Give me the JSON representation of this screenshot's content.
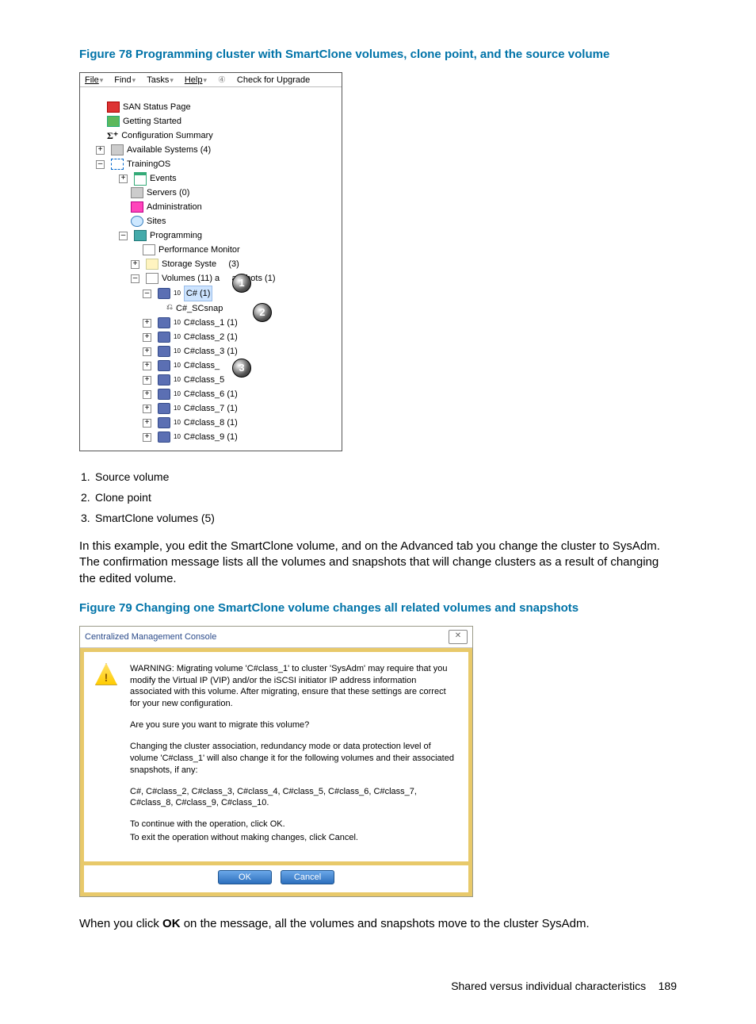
{
  "figure78": {
    "title": "Figure 78 Programming cluster with SmartClone volumes, clone point, and the source volume",
    "menubar": {
      "file": "File",
      "find": "Find",
      "tasks": "Tasks",
      "help": "Help",
      "check": "Check for Upgrade"
    },
    "tree": {
      "san": "SAN Status Page",
      "getting": "Getting Started",
      "config": "Configuration Summary",
      "avail": "Available Systems (4)",
      "training": "TrainingOS",
      "events": "Events",
      "servers": "Servers (0)",
      "admin": "Administration",
      "sites": "Sites",
      "programming": "Programming",
      "perf": "Performance Monitor",
      "storage_pre": "Storage Syste",
      "storage_post": "(3)",
      "volumes_pre": "Volumes (11) a",
      "volumes_post": "apshots (1)",
      "csharp": "C# (1)",
      "scsnap": "C#_SCsnap",
      "c1": "C#class_1 (1)",
      "c2": "C#class_2 (1)",
      "c3": "C#class_3 (1)",
      "c4pre": "C#class_",
      "c5": "C#class_5",
      "c6": "C#class_6 (1)",
      "c7": "C#class_7 (1)",
      "c8": "C#class_8 (1)",
      "c9": "C#class_9 (1)"
    },
    "callouts": {
      "one": "1",
      "two": "2",
      "three": "3"
    }
  },
  "legend": {
    "i1": "1.",
    "t1": "Source volume",
    "i2": "2.",
    "t2": "Clone point",
    "i3": "3.",
    "t3": "SmartClone volumes (5)"
  },
  "para1": "In this example, you edit the SmartClone volume, and on the Advanced tab you change the cluster to SysAdm. The confirmation message lists all the volumes and snapshots that will change clusters as a result of changing the edited volume.",
  "figure79": {
    "title": "Figure 79 Changing one SmartClone volume changes all related volumes and snapshots",
    "dialog_title": "Centralized Management Console",
    "p1": "WARNING: Migrating volume 'C#class_1' to cluster 'SysAdm' may require that you modify the Virtual IP (VIP) and/or the iSCSI initiator IP address information associated with this volume. After migrating, ensure that these settings are correct for your new configuration.",
    "p2": "Are you sure you want to migrate this volume?",
    "p3": "Changing the cluster association, redundancy mode or data protection level of volume 'C#class_1' will also change it for the following volumes and their associated snapshots, if any:",
    "p4": "C#, C#class_2, C#class_3, C#class_4, C#class_5, C#class_6, C#class_7, C#class_8, C#class_9, C#class_10.",
    "p5": "To continue with the operation, click OK.",
    "p6": "To exit the operation without making changes, click Cancel.",
    "ok": "OK",
    "cancel": "Cancel"
  },
  "para2_pre": "When you click ",
  "para2_bold": "OK",
  "para2_post": " on the message, all the volumes and snapshots move to the cluster SysAdm.",
  "footer": {
    "label": "Shared versus individual characteristics",
    "page": "189"
  }
}
